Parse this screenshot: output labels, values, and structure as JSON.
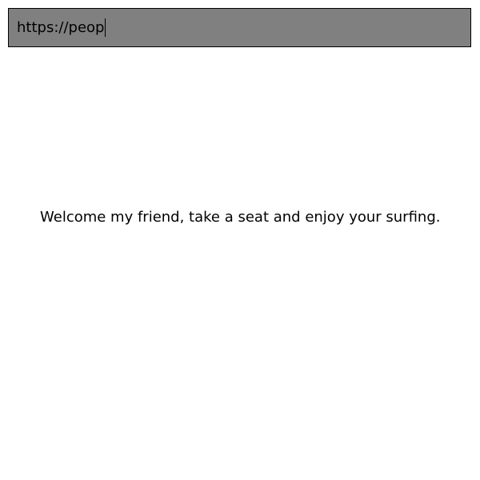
{
  "address_bar": {
    "value": "https://peop"
  },
  "page": {
    "message": "Welcome my friend, take a seat and enjoy your surfing."
  },
  "colors": {
    "address_bar_bg": "#808080",
    "text": "#000000",
    "page_bg": "#ffffff"
  }
}
